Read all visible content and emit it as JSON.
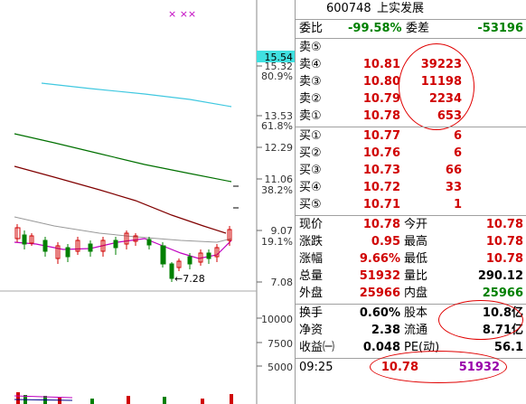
{
  "header": {
    "code": "600748",
    "name": "上实发展"
  },
  "ratio": {
    "label_wb": "委比",
    "wb_value": "-99.58%",
    "label_wc": "委差",
    "wc_value": "-53196"
  },
  "asks": [
    {
      "label": "卖⑤",
      "price": "",
      "volume": ""
    },
    {
      "label": "卖④",
      "price": "10.81",
      "volume": "39223"
    },
    {
      "label": "卖③",
      "price": "10.80",
      "volume": "11198"
    },
    {
      "label": "卖②",
      "price": "10.79",
      "volume": "2234"
    },
    {
      "label": "卖①",
      "price": "10.78",
      "volume": "653"
    }
  ],
  "bids": [
    {
      "label": "买①",
      "price": "10.77",
      "volume": "6"
    },
    {
      "label": "买②",
      "price": "10.76",
      "volume": "6"
    },
    {
      "label": "买③",
      "price": "10.73",
      "volume": "66"
    },
    {
      "label": "买④",
      "price": "10.72",
      "volume": "33"
    },
    {
      "label": "买⑤",
      "price": "10.71",
      "volume": "1"
    }
  ],
  "stats": [
    {
      "l1": "现价",
      "v1": "10.78",
      "c1": "red",
      "l2": "今开",
      "v2": "10.78",
      "c2": "red"
    },
    {
      "l1": "涨跌",
      "v1": "0.95",
      "c1": "red",
      "l2": "最高",
      "v2": "10.78",
      "c2": "red"
    },
    {
      "l1": "涨幅",
      "v1": "9.66%",
      "c1": "red",
      "l2": "最低",
      "v2": "10.78",
      "c2": "red"
    },
    {
      "l1": "总量",
      "v1": "51932",
      "c1": "red",
      "l2": "量比",
      "v2": "290.12",
      "c2": "blk"
    },
    {
      "l1": "外盘",
      "v1": "25966",
      "c1": "red",
      "l2": "内盘",
      "v2": "25966",
      "c2": "green"
    }
  ],
  "finance": [
    {
      "l1": "换手",
      "v1": "0.60%",
      "l2": "股本",
      "v2": "10.8亿"
    },
    {
      "l1": "净资",
      "v1": "2.38",
      "l2": "流通",
      "v2": "8.71亿"
    },
    {
      "l1": "收益㈠",
      "v1": "0.048",
      "l2": "PE(动)",
      "v2": "56.1"
    }
  ],
  "tick": {
    "time": "09:25",
    "price": "10.78",
    "volume": "51932"
  },
  "chart": {
    "price_labels": [
      "15.54",
      "15.32",
      "80.9%",
      "13.53",
      "61.8%",
      "12.29",
      "11.06",
      "38.2%",
      "9.07",
      "19.1%",
      "7.08"
    ],
    "volume_labels": [
      "10000",
      "7500",
      "5000"
    ],
    "low_label": "←7.28",
    "markers": "×    ××",
    "colors": {
      "ma_cyan": "#40c8e0",
      "ma_green": "#007000",
      "ma_darkred": "#800000",
      "ma_purple": "#c000c0",
      "up": "#d00000",
      "down": "#008000",
      "highlight": "#40e0e0"
    }
  }
}
